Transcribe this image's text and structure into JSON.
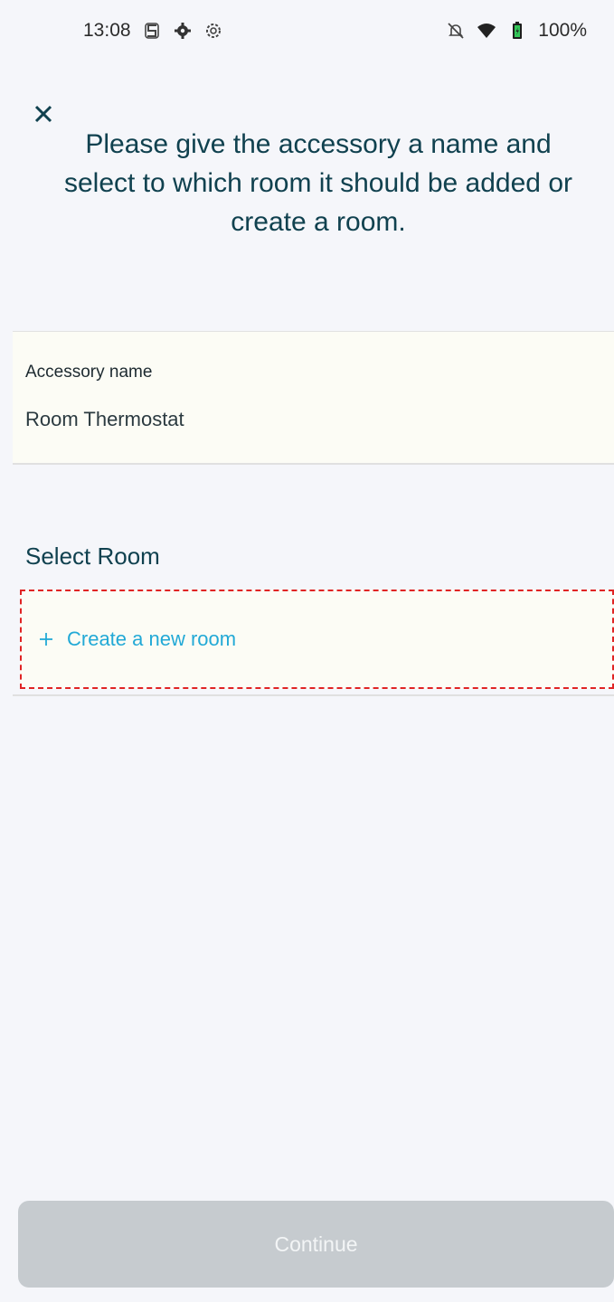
{
  "status_bar": {
    "time": "13:08",
    "left_icons": [
      "s-icon",
      "gear-icon",
      "settings-icon"
    ],
    "right_icons": [
      "notifications-off-icon",
      "wifi-icon",
      "battery-icon"
    ],
    "battery": "100%"
  },
  "header": {
    "close_icon": "close-icon",
    "title": "Please give the accessory a name and select to which room it should be added or create a room."
  },
  "accessory": {
    "label": "Accessory name",
    "value": "Room Thermostat"
  },
  "room_section": {
    "heading": "Select Room",
    "create_label": "Create a new room",
    "create_icon": "plus-icon"
  },
  "footer": {
    "continue_label": "Continue"
  },
  "colors": {
    "title_text": "#10414f",
    "link": "#22a9d6",
    "button_disabled": "#c6cbcf",
    "highlight_border": "#e02424"
  }
}
